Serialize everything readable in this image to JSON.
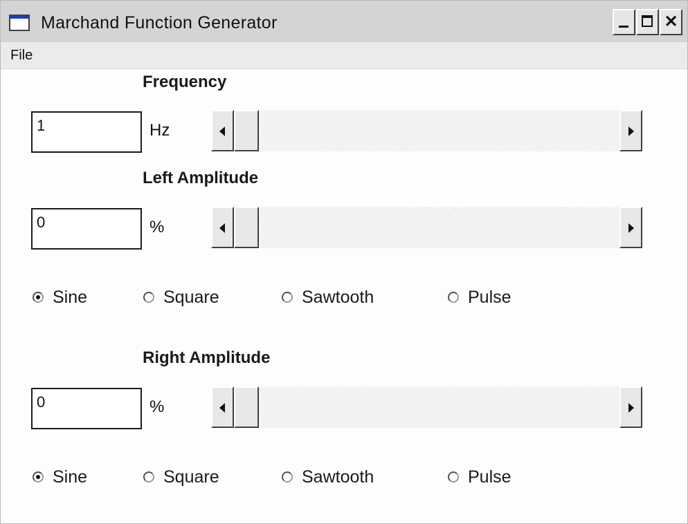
{
  "window": {
    "title": "Marchand Function Generator",
    "minimize_label": "_",
    "close_label": "✕"
  },
  "menu": {
    "file": "File"
  },
  "frequency": {
    "label": "Frequency",
    "value": "1",
    "unit": "Hz",
    "slider_position": 0
  },
  "left_amplitude": {
    "label": "Left Amplitude",
    "value": "0",
    "unit": "%",
    "slider_position": 0,
    "waveforms": [
      "Sine",
      "Square",
      "Sawtooth",
      "Pulse"
    ],
    "selected": "Sine"
  },
  "right_amplitude": {
    "label": "Right Amplitude",
    "value": "0",
    "unit": "%",
    "slider_position": 0,
    "waveforms": [
      "Sine",
      "Square",
      "Sawtooth",
      "Pulse"
    ],
    "selected": "Sine"
  },
  "colors": {
    "titlebar": "#d4d4d4",
    "menubar": "#ebebeb",
    "client": "#fdfdfd"
  }
}
